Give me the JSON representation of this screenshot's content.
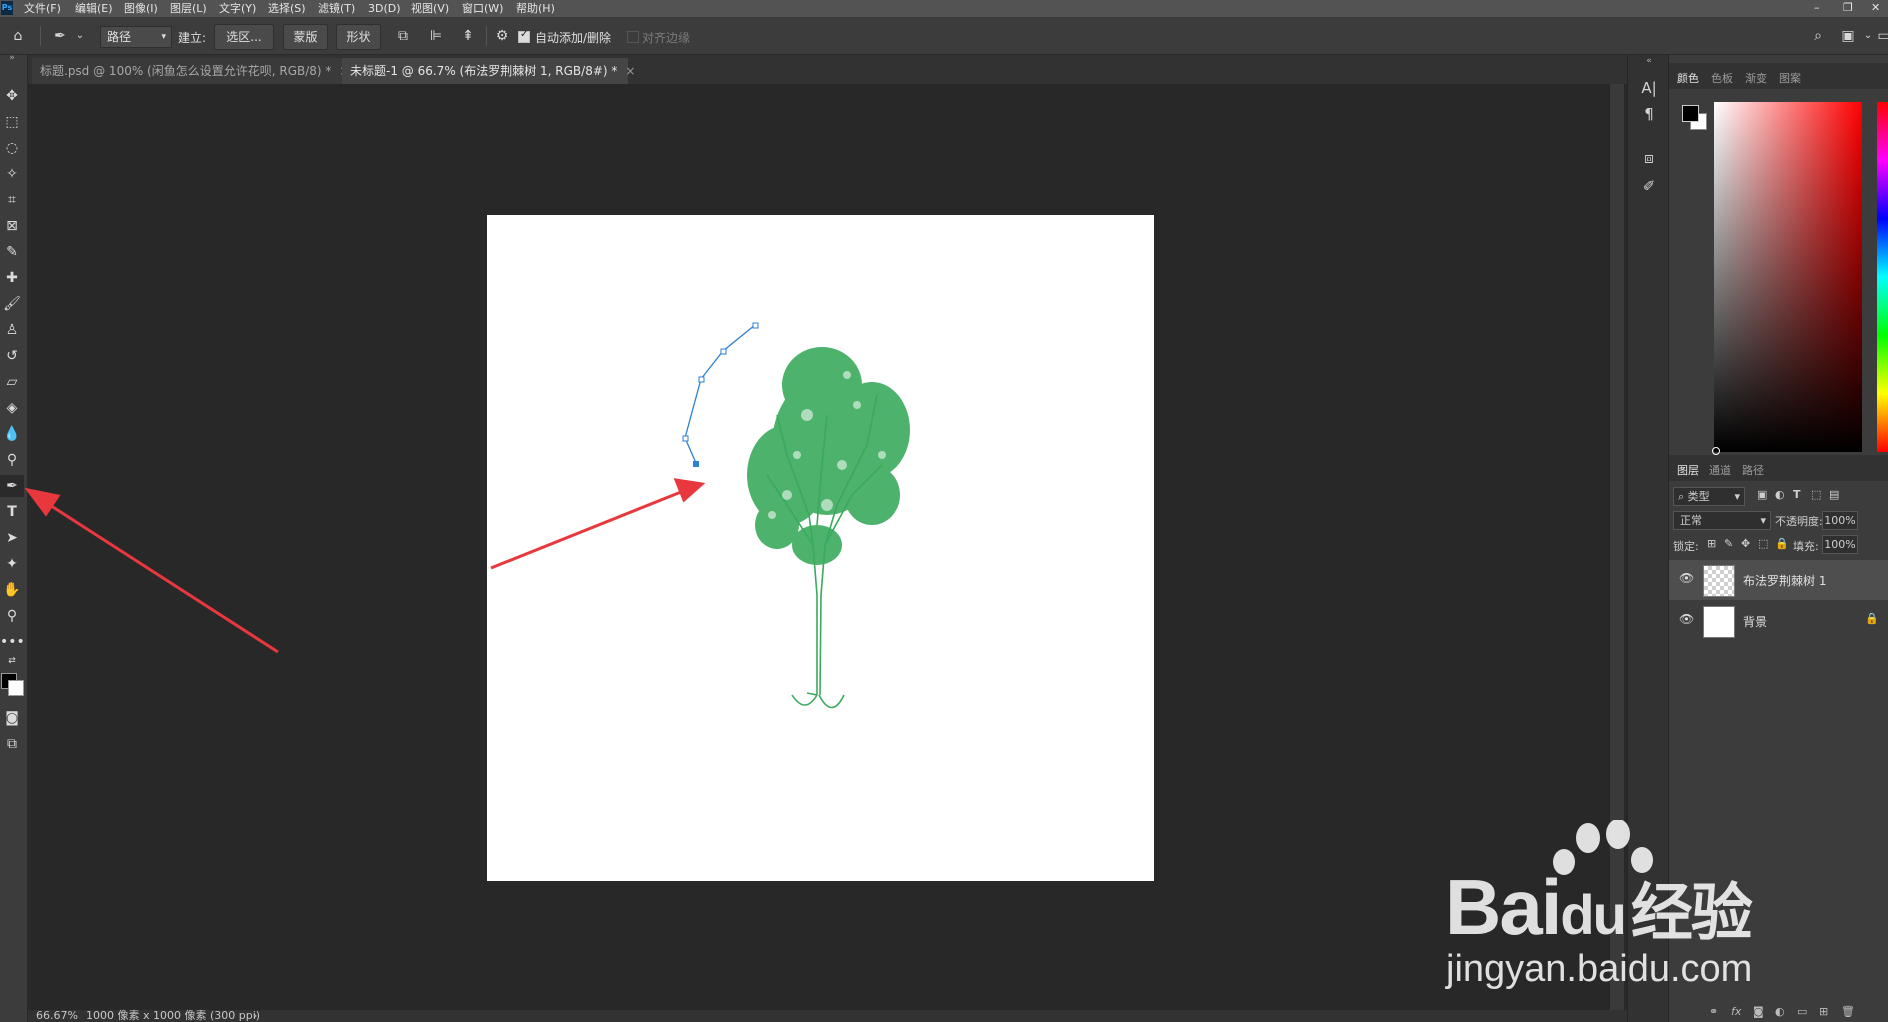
{
  "app": {
    "badge": "Ps"
  },
  "menu": [
    "文件(F)",
    "编辑(E)",
    "图像(I)",
    "图层(L)",
    "文字(Y)",
    "选择(S)",
    "滤镜(T)",
    "3D(D)",
    "视图(V)",
    "窗口(W)",
    "帮助(H)"
  ],
  "window_controls": {
    "minimize": "–",
    "restore": "❐",
    "close": "✕"
  },
  "options": {
    "mode": "路径",
    "make_label": "建立:",
    "selection_button": "选区...",
    "mask_button": "蒙版",
    "shape_button": "形状",
    "auto_add_delete": "自动添加/删除",
    "align_edges": "对齐边缘",
    "auto_add_checked": true
  },
  "tabs": [
    {
      "label": "标题.psd @ 100% (闲鱼怎么设置允许花呗, RGB/8) *",
      "close": "×",
      "active": false
    },
    {
      "label": "未标题-1 @ 66.7% (布法罗荆棘树 1, RGB/8#) *",
      "close": "×",
      "active": true
    }
  ],
  "status": {
    "zoom": "66.67%",
    "doc_info": "1000 像素 x 1000 像素 (300 ppi)",
    "arrow": "›"
  },
  "color_panel": {
    "tabs": [
      "颜色",
      "色板",
      "渐变",
      "图案"
    ],
    "active_tab": "颜色",
    "foreground": "#000000",
    "background": "#ffffff",
    "hue": "#ff0000"
  },
  "layers_panel": {
    "tabs": [
      "图层",
      "通道",
      "路径"
    ],
    "active_tab": "图层",
    "filter_label": "类型",
    "blend_mode": "正常",
    "opacity_label": "不透明度:",
    "opacity_value": "100%",
    "lock_label": "锁定:",
    "fill_label": "填充:",
    "fill_value": "100%",
    "layers": [
      {
        "name": "布法罗荆棘树 1",
        "visible": true,
        "selected": true,
        "transparent": true
      },
      {
        "name": "背景",
        "visible": true,
        "selected": false,
        "locked": true
      }
    ]
  },
  "watermark": {
    "brand": "Bai",
    "brand_suffix": "du",
    "product": "经验",
    "url": "jingyan.baidu.com"
  },
  "colors": {
    "annotation_arrow": "#e8383d",
    "path": "#2f7fd6",
    "tree": "#3aaa5c"
  }
}
